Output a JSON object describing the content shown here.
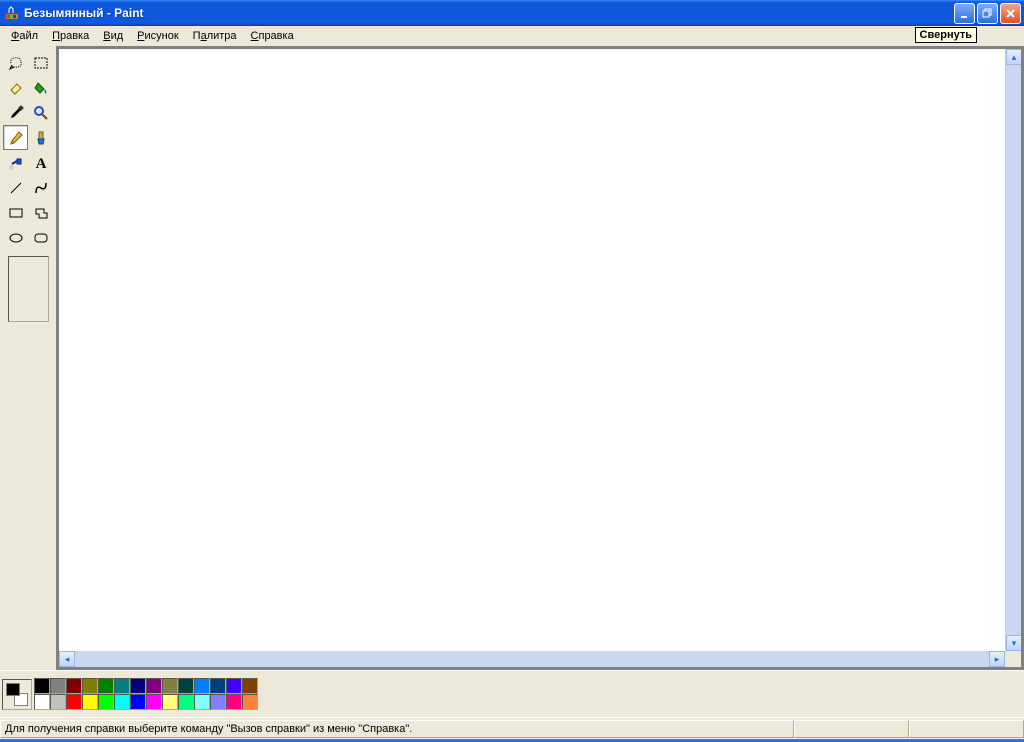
{
  "title": "Безымянный - Paint",
  "tooltip_minimize": "Свернуть",
  "menu": {
    "file": "Файл",
    "edit": "Правка",
    "view": "Вид",
    "image": "Рисунок",
    "palette": "Палитра",
    "help": "Справка"
  },
  "tools": [
    {
      "name": "free-select",
      "selected": false
    },
    {
      "name": "rect-select",
      "selected": false
    },
    {
      "name": "eraser",
      "selected": false
    },
    {
      "name": "fill",
      "selected": false
    },
    {
      "name": "eyedropper",
      "selected": false
    },
    {
      "name": "zoom",
      "selected": false
    },
    {
      "name": "pencil",
      "selected": true
    },
    {
      "name": "brush",
      "selected": false
    },
    {
      "name": "airbrush",
      "selected": false
    },
    {
      "name": "text",
      "selected": false
    },
    {
      "name": "line",
      "selected": false
    },
    {
      "name": "curve",
      "selected": false
    },
    {
      "name": "rectangle",
      "selected": false
    },
    {
      "name": "polygon",
      "selected": false
    },
    {
      "name": "ellipse",
      "selected": false
    },
    {
      "name": "rounded-rect",
      "selected": false
    }
  ],
  "colors": {
    "foreground": "#000000",
    "background": "#ffffff",
    "palette": [
      "#000000",
      "#808080",
      "#800000",
      "#808000",
      "#008000",
      "#008080",
      "#000080",
      "#800080",
      "#808040",
      "#004040",
      "#0080ff",
      "#004080",
      "#4000ff",
      "#804000",
      "#ffffff",
      "#c0c0c0",
      "#ff0000",
      "#ffff00",
      "#00ff00",
      "#00ffff",
      "#0000ff",
      "#ff00ff",
      "#ffff80",
      "#00ff80",
      "#80ffff",
      "#8080ff",
      "#ff0080",
      "#ff8040"
    ]
  },
  "status": "Для получения справки выберите команду \"Вызов справки\" из меню \"Справка\"."
}
